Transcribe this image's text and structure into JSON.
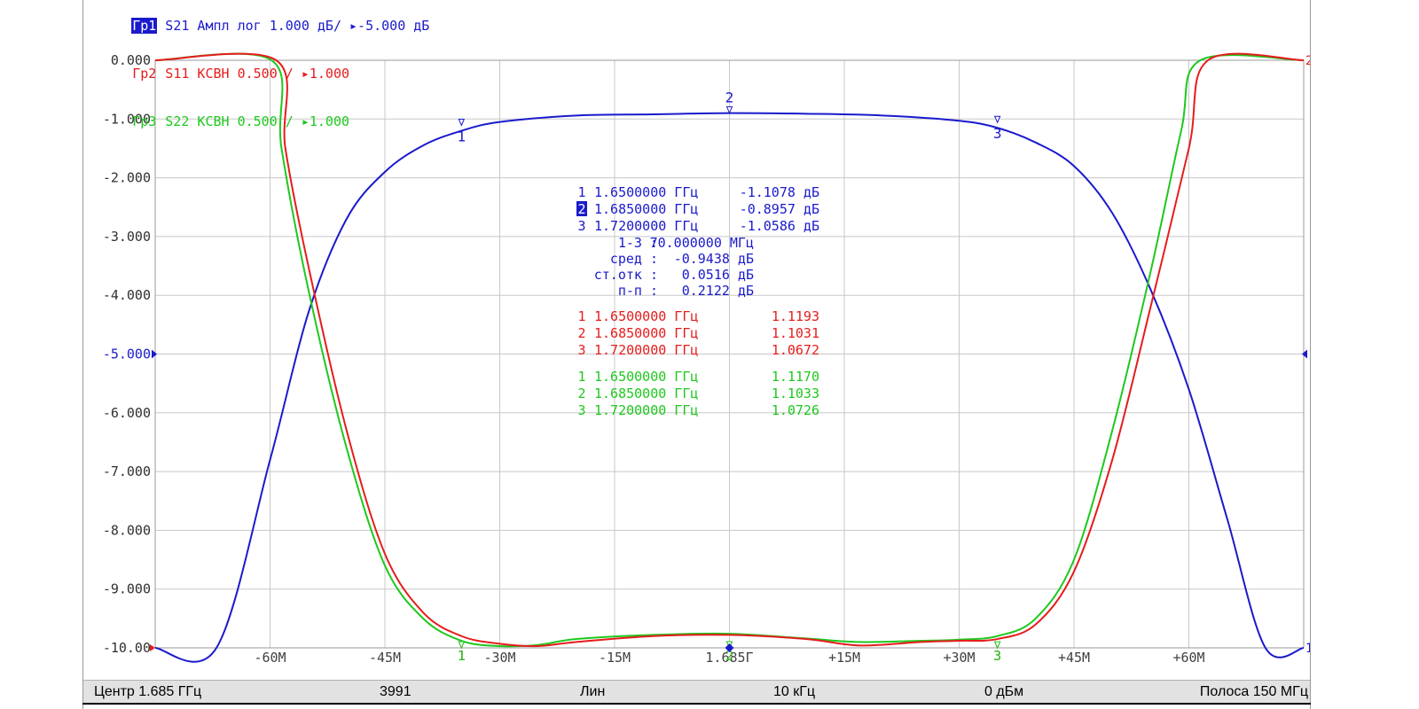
{
  "colors": {
    "trace1": "#1a1acc",
    "trace2": "#e61c1c",
    "trace3": "#1ec81e",
    "grid": "#c8c8c8",
    "status_bar": "#e2e2e2"
  },
  "trace_headers": [
    {
      "tag": "Гр1",
      "text": " S21 Ампл лог 1.000 дБ/ ▸-5.000 дБ",
      "color": "#1a1acc",
      "active": true
    },
    {
      "tag": "Гр2",
      "text": " S11 КСВН 0.500 / ▸1.000",
      "color": "#e61c1c",
      "active": false
    },
    {
      "tag": "Гр3",
      "text": " S22 КСВН 0.500 / ▸1.000",
      "color": "#1ec81e",
      "active": false
    }
  ],
  "status_bar": {
    "center": "Центр 1.685 ГГц",
    "points": "3991",
    "sweep_type": "Лин",
    "ifbw": "10 кГц",
    "power": "0 дБм",
    "span": "Полоса 150 МГц"
  },
  "markers_readout": {
    "trace1": [
      {
        "n": "1",
        "freq": "1.6500000 ГГц",
        "value": "-1.1078 дБ",
        "active": false
      },
      {
        "n": "2",
        "freq": "1.6850000 ГГц",
        "value": "-0.8957 дБ",
        "active": true
      },
      {
        "n": "3",
        "freq": "1.7200000 ГГц",
        "value": "-1.0586 дБ",
        "active": false
      }
    ],
    "stats": [
      {
        "label": "1-3 :",
        "value": "70.000000 МГц"
      },
      {
        "label": "сред :",
        "value": "-0.9438 дБ"
      },
      {
        "label": "ст.отк :",
        "value": "0.0516 дБ"
      },
      {
        "label": "п-п :",
        "value": "0.2122 дБ"
      }
    ],
    "trace2": [
      {
        "n": "1",
        "freq": "1.6500000 ГГц",
        "value": "1.1193"
      },
      {
        "n": "2",
        "freq": "1.6850000 ГГц",
        "value": "1.1031"
      },
      {
        "n": "3",
        "freq": "1.7200000 ГГц",
        "value": "1.0672"
      }
    ],
    "trace3": [
      {
        "n": "1",
        "freq": "1.6500000 ГГц",
        "value": "1.1170"
      },
      {
        "n": "2",
        "freq": "1.6850000 ГГц",
        "value": "1.1033"
      },
      {
        "n": "3",
        "freq": "1.7200000 ГГц",
        "value": "1.0726"
      }
    ]
  },
  "chart_data": {
    "type": "line",
    "x_unit": "МГц offset from center",
    "xlim": [
      -75,
      75
    ],
    "ylim": [
      -10,
      0
    ],
    "grid": true,
    "y_ticks": [
      "0.000",
      "-1.000",
      "-2.000",
      "-3.000",
      "-4.000",
      "-5.000",
      "-6.000",
      "-7.000",
      "-8.000",
      "-9.000",
      "-10.00"
    ],
    "y_tick_values": [
      0,
      -1,
      -2,
      -3,
      -4,
      -5,
      -6,
      -7,
      -8,
      -9,
      -10
    ],
    "reference_tick": "-5.000",
    "x_ticks": [
      {
        "label": "-60M",
        "x": -60
      },
      {
        "label": "-45M",
        "x": -45
      },
      {
        "label": "-30M",
        "x": -30
      },
      {
        "label": "-15M",
        "x": -15
      },
      {
        "label": "1.685Г",
        "x": 0
      },
      {
        "label": "+15M",
        "x": 15
      },
      {
        "label": "+30M",
        "x": 30
      },
      {
        "label": "+45M",
        "x": 45
      },
      {
        "label": "+60M",
        "x": 60
      }
    ],
    "series": [
      {
        "name": "S21",
        "color": "#1a1acc",
        "points": [
          [
            -75,
            -10
          ],
          [
            -67,
            -10
          ],
          [
            -60,
            -6.8
          ],
          [
            -55,
            -4.3
          ],
          [
            -50,
            -2.7
          ],
          [
            -45,
            -1.9
          ],
          [
            -40,
            -1.45
          ],
          [
            -35,
            -1.2
          ],
          [
            -30,
            -1.05
          ],
          [
            -20,
            -0.94
          ],
          [
            -10,
            -0.92
          ],
          [
            0,
            -0.9
          ],
          [
            10,
            -0.91
          ],
          [
            20,
            -0.94
          ],
          [
            30,
            -1.03
          ],
          [
            35,
            -1.15
          ],
          [
            40,
            -1.4
          ],
          [
            45,
            -1.8
          ],
          [
            50,
            -2.6
          ],
          [
            55,
            -3.9
          ],
          [
            60,
            -5.6
          ],
          [
            65,
            -7.8
          ],
          [
            70,
            -10
          ],
          [
            75,
            -10
          ]
        ],
        "markers": [
          {
            "label": "1",
            "x": -35,
            "y": -1.108
          },
          {
            "label": "2",
            "x": 0,
            "y": -0.896
          },
          {
            "label": "3",
            "x": 35,
            "y": -1.059
          }
        ]
      },
      {
        "name": "S11",
        "color": "#e61c1c",
        "points": [
          [
            -75,
            0
          ],
          [
            -59.2,
            0
          ],
          [
            -58,
            -1.5
          ],
          [
            -55,
            -3.5
          ],
          [
            -50,
            -6.3
          ],
          [
            -45,
            -8.4
          ],
          [
            -40,
            -9.4
          ],
          [
            -35,
            -9.8
          ],
          [
            -30,
            -9.93
          ],
          [
            -25,
            -9.97
          ],
          [
            -20,
            -9.9
          ],
          [
            -10,
            -9.8
          ],
          [
            0,
            -9.78
          ],
          [
            10,
            -9.85
          ],
          [
            17,
            -9.96
          ],
          [
            25,
            -9.9
          ],
          [
            30,
            -9.88
          ],
          [
            35,
            -9.85
          ],
          [
            40,
            -9.6
          ],
          [
            45,
            -8.7
          ],
          [
            50,
            -6.8
          ],
          [
            55,
            -4.2
          ],
          [
            60,
            -1.5
          ],
          [
            62.5,
            0
          ],
          [
            75,
            0
          ]
        ],
        "markers": [
          {
            "label": "1",
            "x": -35,
            "y": -10
          },
          {
            "label": "2",
            "x": 0,
            "y": -10
          },
          {
            "label": "3",
            "x": 35,
            "y": -10
          }
        ]
      },
      {
        "name": "S22",
        "color": "#1ec81e",
        "points": [
          [
            -75,
            0
          ],
          [
            -59.8,
            0
          ],
          [
            -58.5,
            -1.5
          ],
          [
            -55,
            -3.9
          ],
          [
            -50,
            -6.6
          ],
          [
            -45,
            -8.6
          ],
          [
            -40,
            -9.5
          ],
          [
            -35,
            -9.88
          ],
          [
            -30,
            -9.97
          ],
          [
            -25,
            -9.95
          ],
          [
            -20,
            -9.85
          ],
          [
            -10,
            -9.78
          ],
          [
            0,
            -9.76
          ],
          [
            10,
            -9.84
          ],
          [
            17,
            -9.9
          ],
          [
            25,
            -9.88
          ],
          [
            30,
            -9.86
          ],
          [
            35,
            -9.8
          ],
          [
            40,
            -9.5
          ],
          [
            45,
            -8.5
          ],
          [
            50,
            -6.3
          ],
          [
            55,
            -3.6
          ],
          [
            59,
            -1.2
          ],
          [
            61.5,
            0
          ],
          [
            75,
            0
          ]
        ],
        "markers": [
          {
            "label": "1",
            "x": -35,
            "y": -10
          },
          {
            "label": "2",
            "x": 0,
            "y": -10
          },
          {
            "label": "3",
            "x": 35,
            "y": -10
          }
        ]
      }
    ],
    "right_edge_labels": [
      {
        "label": "2",
        "y": 0,
        "color": "#e61c1c"
      },
      {
        "label": "1",
        "y": -10,
        "color": "#1a1acc"
      }
    ]
  }
}
